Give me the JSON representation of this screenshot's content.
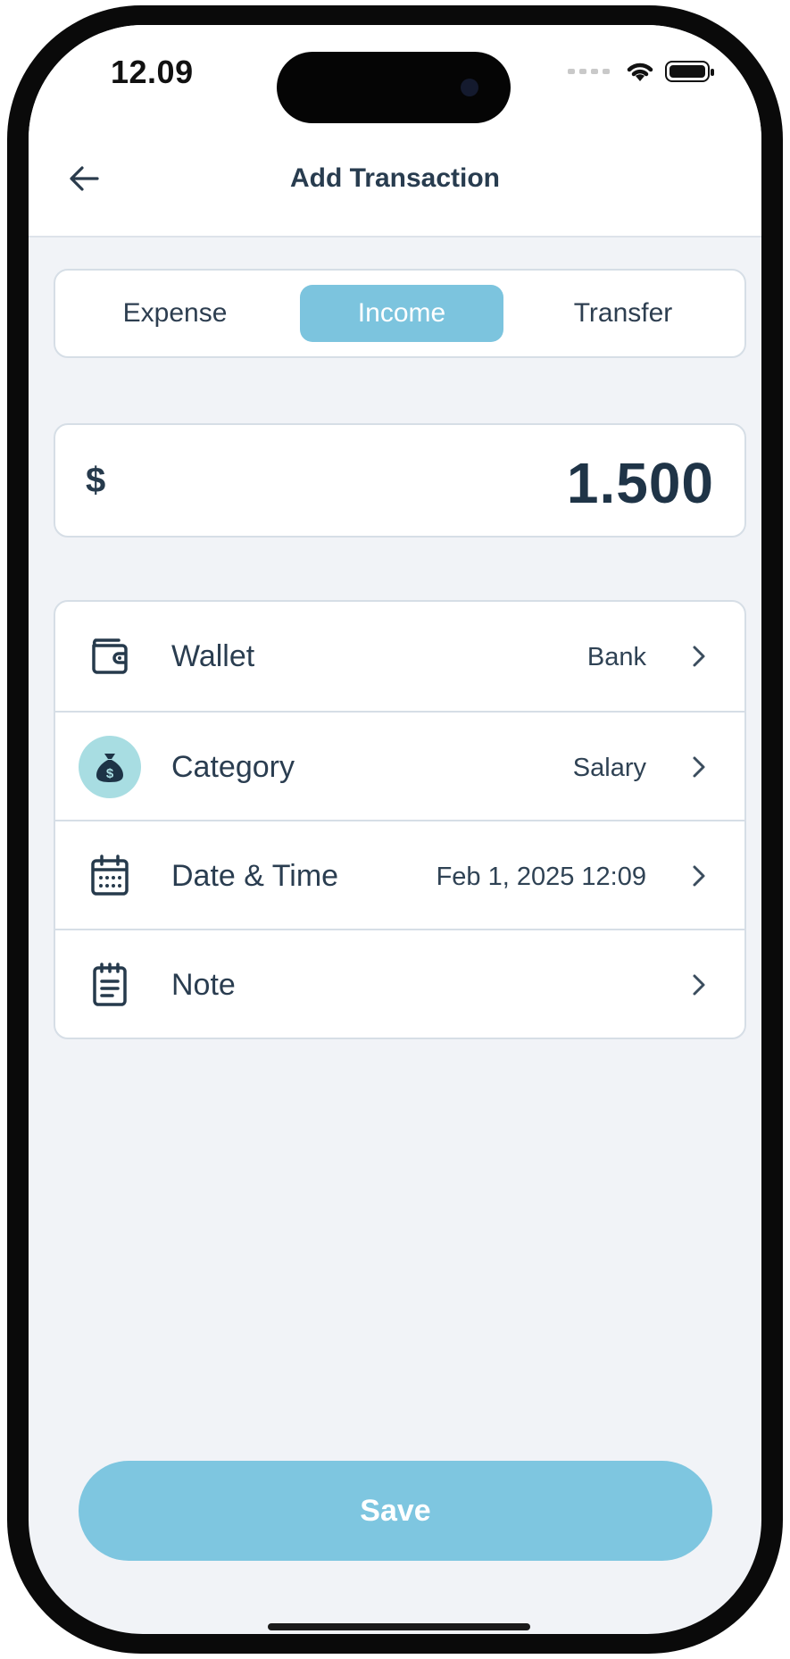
{
  "status_bar": {
    "time": "12.09"
  },
  "header": {
    "title": "Add Transaction"
  },
  "tabs": [
    {
      "label": "Expense",
      "selected": false
    },
    {
      "label": "Income",
      "selected": true
    },
    {
      "label": "Transfer",
      "selected": false
    }
  ],
  "amount": {
    "currency_symbol": "$",
    "value": "1.500"
  },
  "fields": {
    "wallet": {
      "label": "Wallet",
      "value": "Bank",
      "icon": "wallet-icon"
    },
    "category": {
      "label": "Category",
      "value": "Salary",
      "icon": "money-bag-icon"
    },
    "datetime": {
      "label": "Date & Time",
      "value": "Feb 1, 2025 12:09",
      "icon": "calendar-icon"
    },
    "note": {
      "label": "Note",
      "value": "",
      "icon": "notepad-icon"
    }
  },
  "save_button": {
    "label": "Save"
  },
  "colors": {
    "accent": "#7cc4de",
    "text_primary": "#283c4f",
    "background": "#f1f3f7",
    "category_badge": "#a8dde2"
  }
}
